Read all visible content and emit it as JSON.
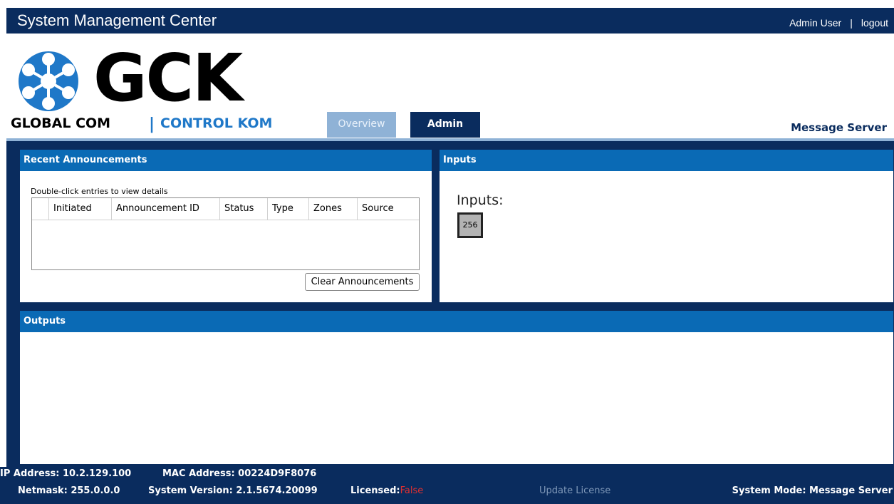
{
  "header": {
    "title": "System Management Center",
    "user": "Admin User",
    "separator": "|",
    "logout": "logout"
  },
  "logo": {
    "wordmark": "GCK",
    "tagline_left": "GLOBAL COM",
    "tagline_sep": "|",
    "tagline_right": "CONTROL KOM",
    "icon": "network-hub-icon"
  },
  "tabs": [
    {
      "label": "Overview",
      "active": true
    },
    {
      "label": "Admin",
      "active": false
    }
  ],
  "server_label": "Message Server",
  "recent_announcements": {
    "title": "Recent Announcements",
    "hint": "Double-click entries to view details",
    "columns": [
      "",
      "Initiated",
      "Announcement ID",
      "Status",
      "Type",
      "Zones",
      "Source"
    ],
    "rows": [],
    "clear_button": "Clear Announcements"
  },
  "inputs": {
    "title": "Inputs",
    "label": "Inputs:",
    "items": [
      "256"
    ]
  },
  "outputs": {
    "title": "Outputs"
  },
  "footer": {
    "ip": "IP Address: 10.2.129.100",
    "mac": "MAC Address: 00224D9F8076",
    "netmask": "Netmask: 255.0.0.0",
    "version": "System Version:  2.1.5674.20099",
    "licensed_label": "Licensed:",
    "licensed_value": "False",
    "update_license": "Update License",
    "system_mode": "System Mode:  Message Server"
  },
  "colors": {
    "navy": "#0a2c5e",
    "header_blue": "#0a6ab5",
    "tab_inactive": "#8fb2d6",
    "brand_blue": "#1f78c8",
    "licensed_false": "#e03030"
  }
}
